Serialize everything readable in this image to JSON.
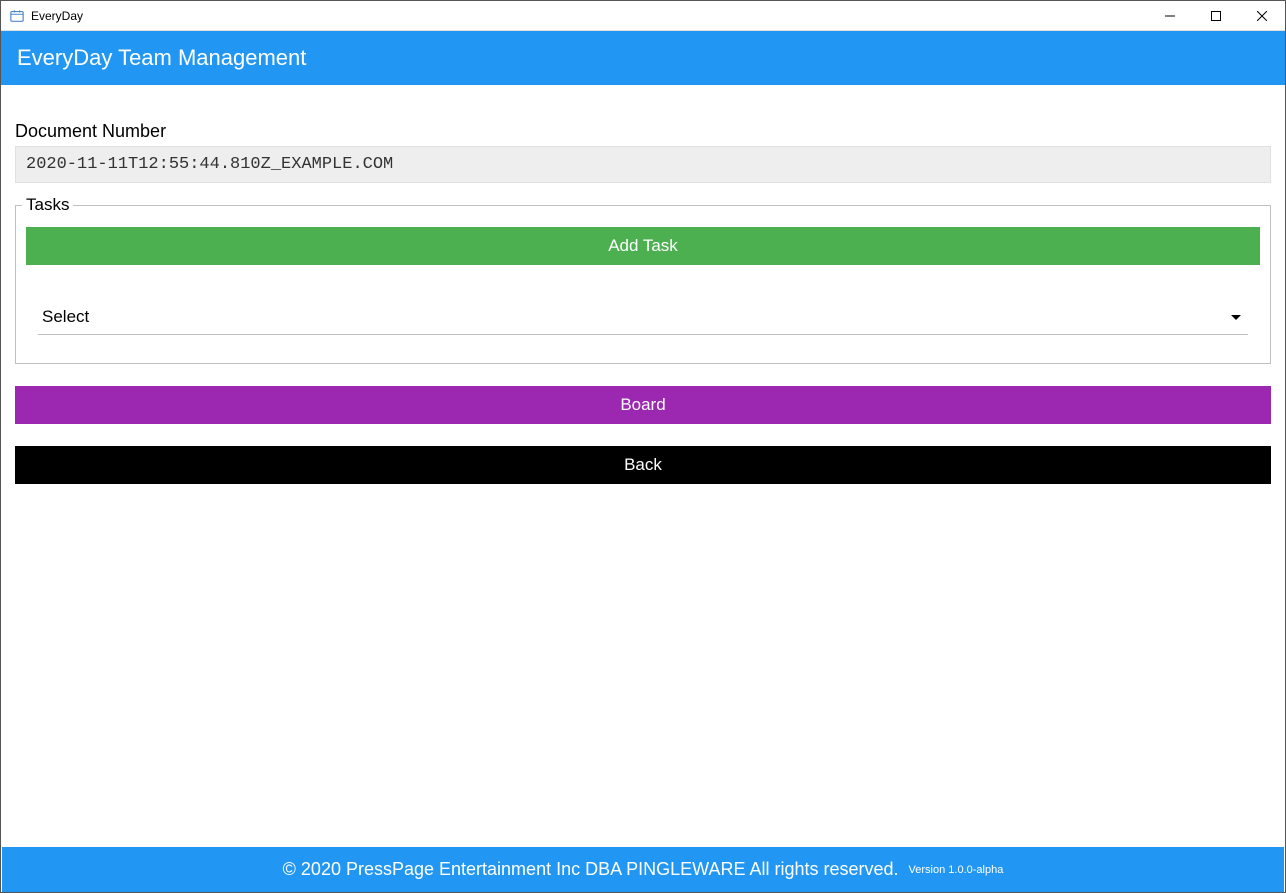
{
  "window": {
    "title": "EveryDay"
  },
  "header": {
    "title": "EveryDay Team Management"
  },
  "form": {
    "document_number_label": "Document Number",
    "document_number_value": "2020-11-11T12:55:44.810Z_EXAMPLE.COM"
  },
  "tasks": {
    "legend": "Tasks",
    "add_button_label": "Add Task",
    "select_placeholder": "Select"
  },
  "buttons": {
    "board_label": "Board",
    "back_label": "Back"
  },
  "footer": {
    "copyright": "© 2020 PressPage Entertainment Inc DBA PINGLEWARE  All rights reserved.",
    "version": "Version 1.0.0-alpha"
  }
}
